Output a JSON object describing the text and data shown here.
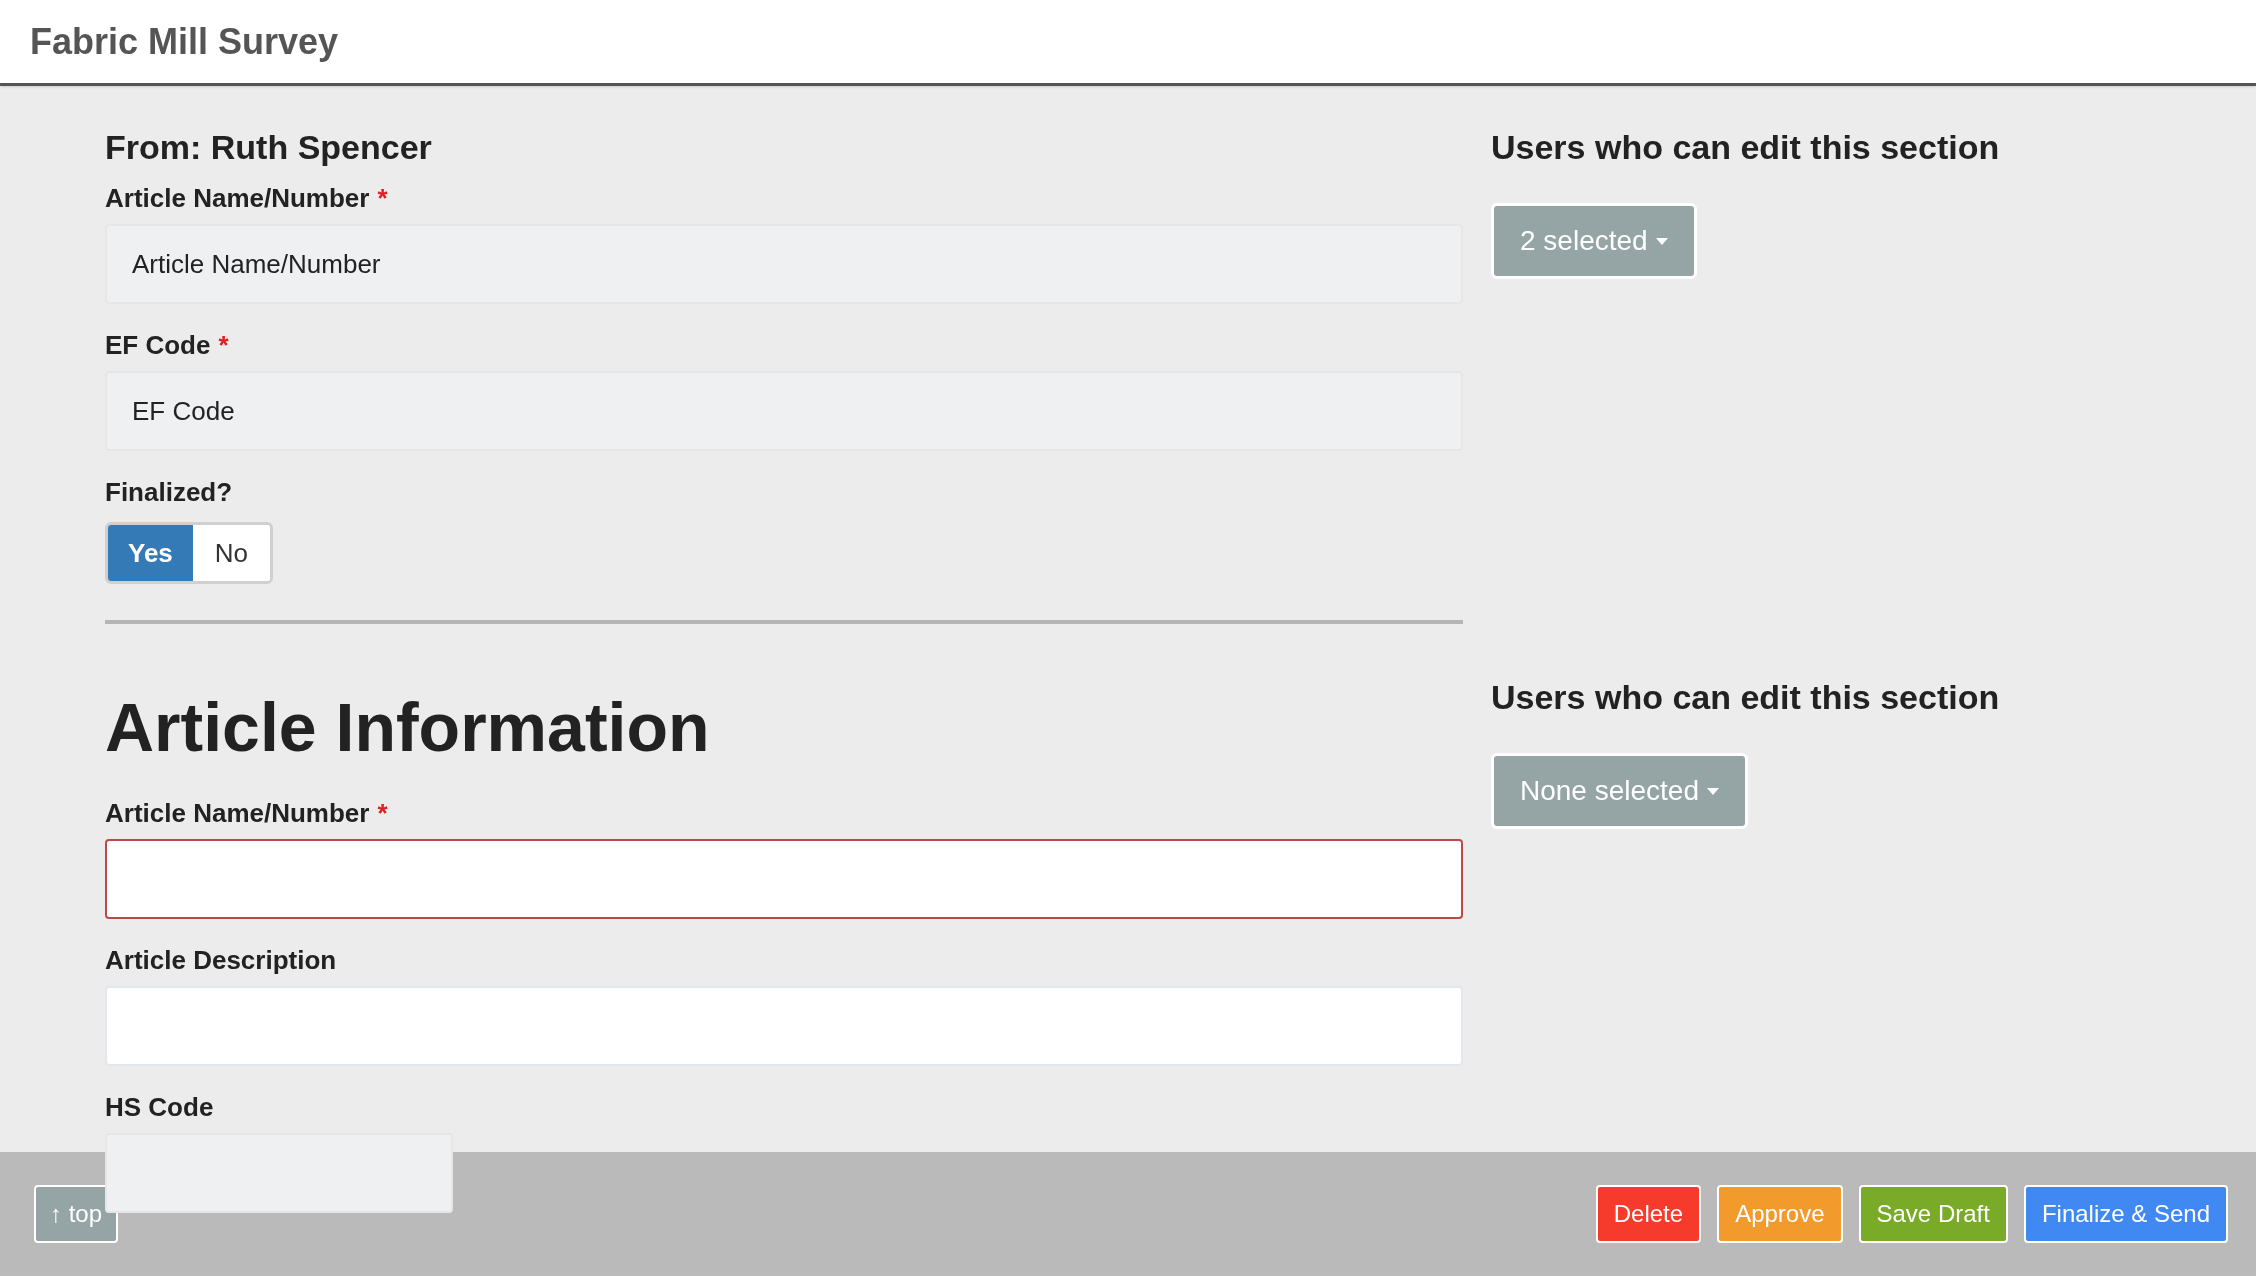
{
  "header": {
    "title": "Fabric Mill Survey"
  },
  "sections": [
    {
      "heading": "From: Ruth Spencer",
      "editors": {
        "label": "Users who can edit this section",
        "button": "2 selected"
      },
      "fields": [
        {
          "kind": "text",
          "label": "Article Name/Number",
          "required_mark": "*",
          "value": "Article Name/Number",
          "disabled": true,
          "invalid": false
        },
        {
          "kind": "text",
          "label": "EF Code",
          "required_mark": "*",
          "value": "EF Code",
          "disabled": true,
          "invalid": false
        },
        {
          "kind": "toggle",
          "label": "Finalized?",
          "options": [
            {
              "label": "Yes",
              "selected": true
            },
            {
              "label": "No",
              "selected": false
            }
          ]
        }
      ]
    },
    {
      "heading": "Article Information",
      "editors": {
        "label": "Users who can edit this section",
        "button": "None selected"
      },
      "fields": [
        {
          "kind": "text",
          "label": "Article Name/Number",
          "required_mark": "*",
          "disabled": false,
          "invalid": true
        },
        {
          "kind": "text",
          "label": "Article Description",
          "disabled": false,
          "invalid": false
        },
        {
          "kind": "short_text",
          "label": "HS Code",
          "disabled": true,
          "invalid": false
        }
      ]
    }
  ],
  "footer": {
    "top_button": "↑ top",
    "actions": [
      {
        "label": "Delete",
        "color": "#f63a2c"
      },
      {
        "label": "Approve",
        "color": "#f39a2d"
      },
      {
        "label": "Save Draft",
        "color": "#7aab28"
      },
      {
        "label": "Finalize & Send",
        "color": "#4189f2"
      }
    ]
  }
}
